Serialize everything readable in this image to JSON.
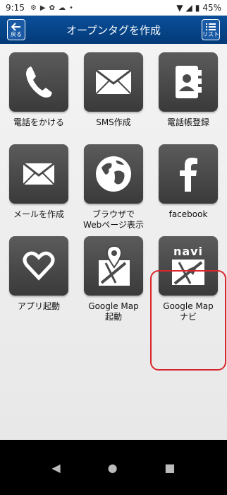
{
  "status": {
    "time": "9:15",
    "battery": "45%"
  },
  "header": {
    "title": "オープンタグを作成",
    "back_label": "戻る",
    "list_label": "リスト"
  },
  "tiles": [
    {
      "label": "電話をかける",
      "icon": "phone-icon"
    },
    {
      "label": "SMS作成",
      "icon": "envelope-icon"
    },
    {
      "label": "電話帳登録",
      "icon": "contacts-icon"
    },
    {
      "label": "メールを作成",
      "icon": "mail-icon"
    },
    {
      "label": "ブラウザで\nWebページ表示",
      "icon": "globe-icon"
    },
    {
      "label": "facebook",
      "icon": "facebook-icon"
    },
    {
      "label": "アプリ起動",
      "icon": "heart-icon"
    },
    {
      "label": "Google Map\n起動",
      "icon": "map-pin-icon"
    },
    {
      "label": "Google Map\nナビ",
      "icon": "navi-map-icon",
      "icon_text": "navi"
    }
  ],
  "colors": {
    "header": "#0a4f9a",
    "tile": "#4a4a4a",
    "highlight": "#d9262c"
  }
}
